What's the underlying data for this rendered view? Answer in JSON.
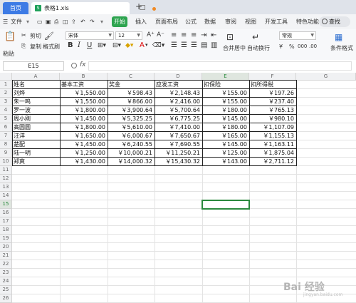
{
  "tabs": {
    "home": "首页",
    "doc": "表格1.xls",
    "doc_icon": "S"
  },
  "menu": {
    "file": "文件",
    "start": "开始",
    "items": [
      "插入",
      "页面布局",
      "公式",
      "数据",
      "审阅",
      "视图",
      "开发工具",
      "特色功能"
    ],
    "search": "查找"
  },
  "ribbon": {
    "paste": "粘贴",
    "cut": "剪切",
    "copy": "复制",
    "format_painter": "格式刷",
    "font_name": "宋体",
    "font_size": "12",
    "merge": "合并居中",
    "wrap": "自动换行",
    "number_format": "常规",
    "percent": "%",
    "currency": "¥",
    "cond_format": "条件格式",
    "bold": "B",
    "italic": "I",
    "underline": "U",
    "font_color": "A"
  },
  "formula_bar": {
    "cell_ref": "E15",
    "fx": "fx",
    "value": ""
  },
  "sheet": {
    "columns": [
      "A",
      "B",
      "C",
      "D",
      "E",
      "F",
      "G"
    ],
    "row_numbers": [
      "1",
      "2",
      "3",
      "4",
      "5",
      "6",
      "7",
      "8",
      "9",
      "10",
      "11",
      "12",
      "13",
      "14",
      "15",
      "16",
      "17",
      "18",
      "19",
      "20",
      "21",
      "22",
      "23",
      "24",
      "25",
      "26"
    ],
    "header": [
      "姓名",
      "基本工资",
      "奖金",
      "应发工资",
      "扣保险",
      "扣所得税"
    ],
    "rows": [
      [
        "刘烨",
        "￥1,550.00",
        "￥598.43",
        "￥2,148.43",
        "￥155.00",
        "￥197.26"
      ],
      [
        "朱一鸣",
        "￥1,550.00",
        "￥866.00",
        "￥2,416.00",
        "￥155.00",
        "￥237.40"
      ],
      [
        "罗一波",
        "￥1,800.00",
        "￥3,900.64",
        "￥5,700.64",
        "￥180.00",
        "￥765.13"
      ],
      [
        "周小刚",
        "￥1,450.00",
        "￥5,325.25",
        "￥6,775.25",
        "￥145.00",
        "￥980.10"
      ],
      [
        "高圆圆",
        "￥1,800.00",
        "￥5,610.00",
        "￥7,410.00",
        "￥180.00",
        "￥1,107.09"
      ],
      [
        "汪洋",
        "￥1,650.00",
        "￥6,000.67",
        "￥7,650.67",
        "￥165.00",
        "￥1,155.13"
      ],
      [
        "楚配",
        "￥1,450.00",
        "￥6,240.55",
        "￥7,690.55",
        "￥145.00",
        "￥1,163.11"
      ],
      [
        "陆一明",
        "￥1,250.00",
        "￥10,000.21",
        "￥11,250.21",
        "￥125.00",
        "￥1,875.04"
      ],
      [
        "郑爽",
        "￥1,430.00",
        "￥14,000.32",
        "￥15,430.32",
        "￥143.00",
        "￥2,711.12"
      ]
    ]
  },
  "selected_cell": "E15",
  "watermark": {
    "main": "Bai 经验",
    "sub": "jingyan.baidu.com"
  },
  "colors": {
    "accent": "#3d7be5",
    "start_green": "#2ea44f",
    "selection": "#2b8a3e"
  }
}
